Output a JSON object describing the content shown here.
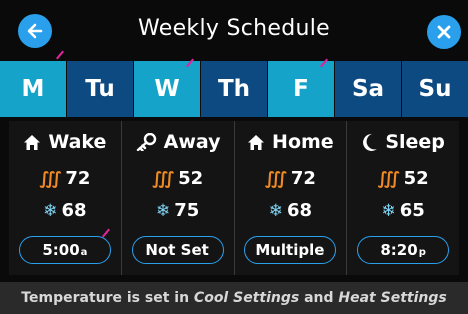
{
  "header": {
    "title": "Weekly Schedule",
    "back_icon": "arrow-left-icon",
    "close_icon": "close-icon",
    "accent_color": "#2aa0ec"
  },
  "days": [
    {
      "label": "M",
      "active": true
    },
    {
      "label": "Tu",
      "active": false
    },
    {
      "label": "W",
      "active": true
    },
    {
      "label": "Th",
      "active": false
    },
    {
      "label": "F",
      "active": true
    },
    {
      "label": "Sa",
      "active": false
    },
    {
      "label": "Su",
      "active": false
    }
  ],
  "periods": [
    {
      "name": "Wake",
      "icon": "house-icon",
      "heat": "72",
      "cool": "68",
      "time": "5:00",
      "ampm": "a"
    },
    {
      "name": "Away",
      "icon": "key-icon",
      "heat": "52",
      "cool": "75",
      "time": "Not Set",
      "ampm": ""
    },
    {
      "name": "Home",
      "icon": "house-icon",
      "heat": "72",
      "cool": "68",
      "time": "Multiple",
      "ampm": ""
    },
    {
      "name": "Sleep",
      "icon": "moon-icon",
      "heat": "52",
      "cool": "65",
      "time": "8:20",
      "ampm": "p"
    }
  ],
  "footer": {
    "prefix": "Temperature is set in ",
    "cool_settings": "Cool Settings",
    "joiner": " and ",
    "heat_settings": "Heat Settings"
  },
  "colors": {
    "day_active": "#16a3c9",
    "day_inactive": "#0d4a82",
    "heat": "#f08a24",
    "cool": "#7fd3f2"
  }
}
